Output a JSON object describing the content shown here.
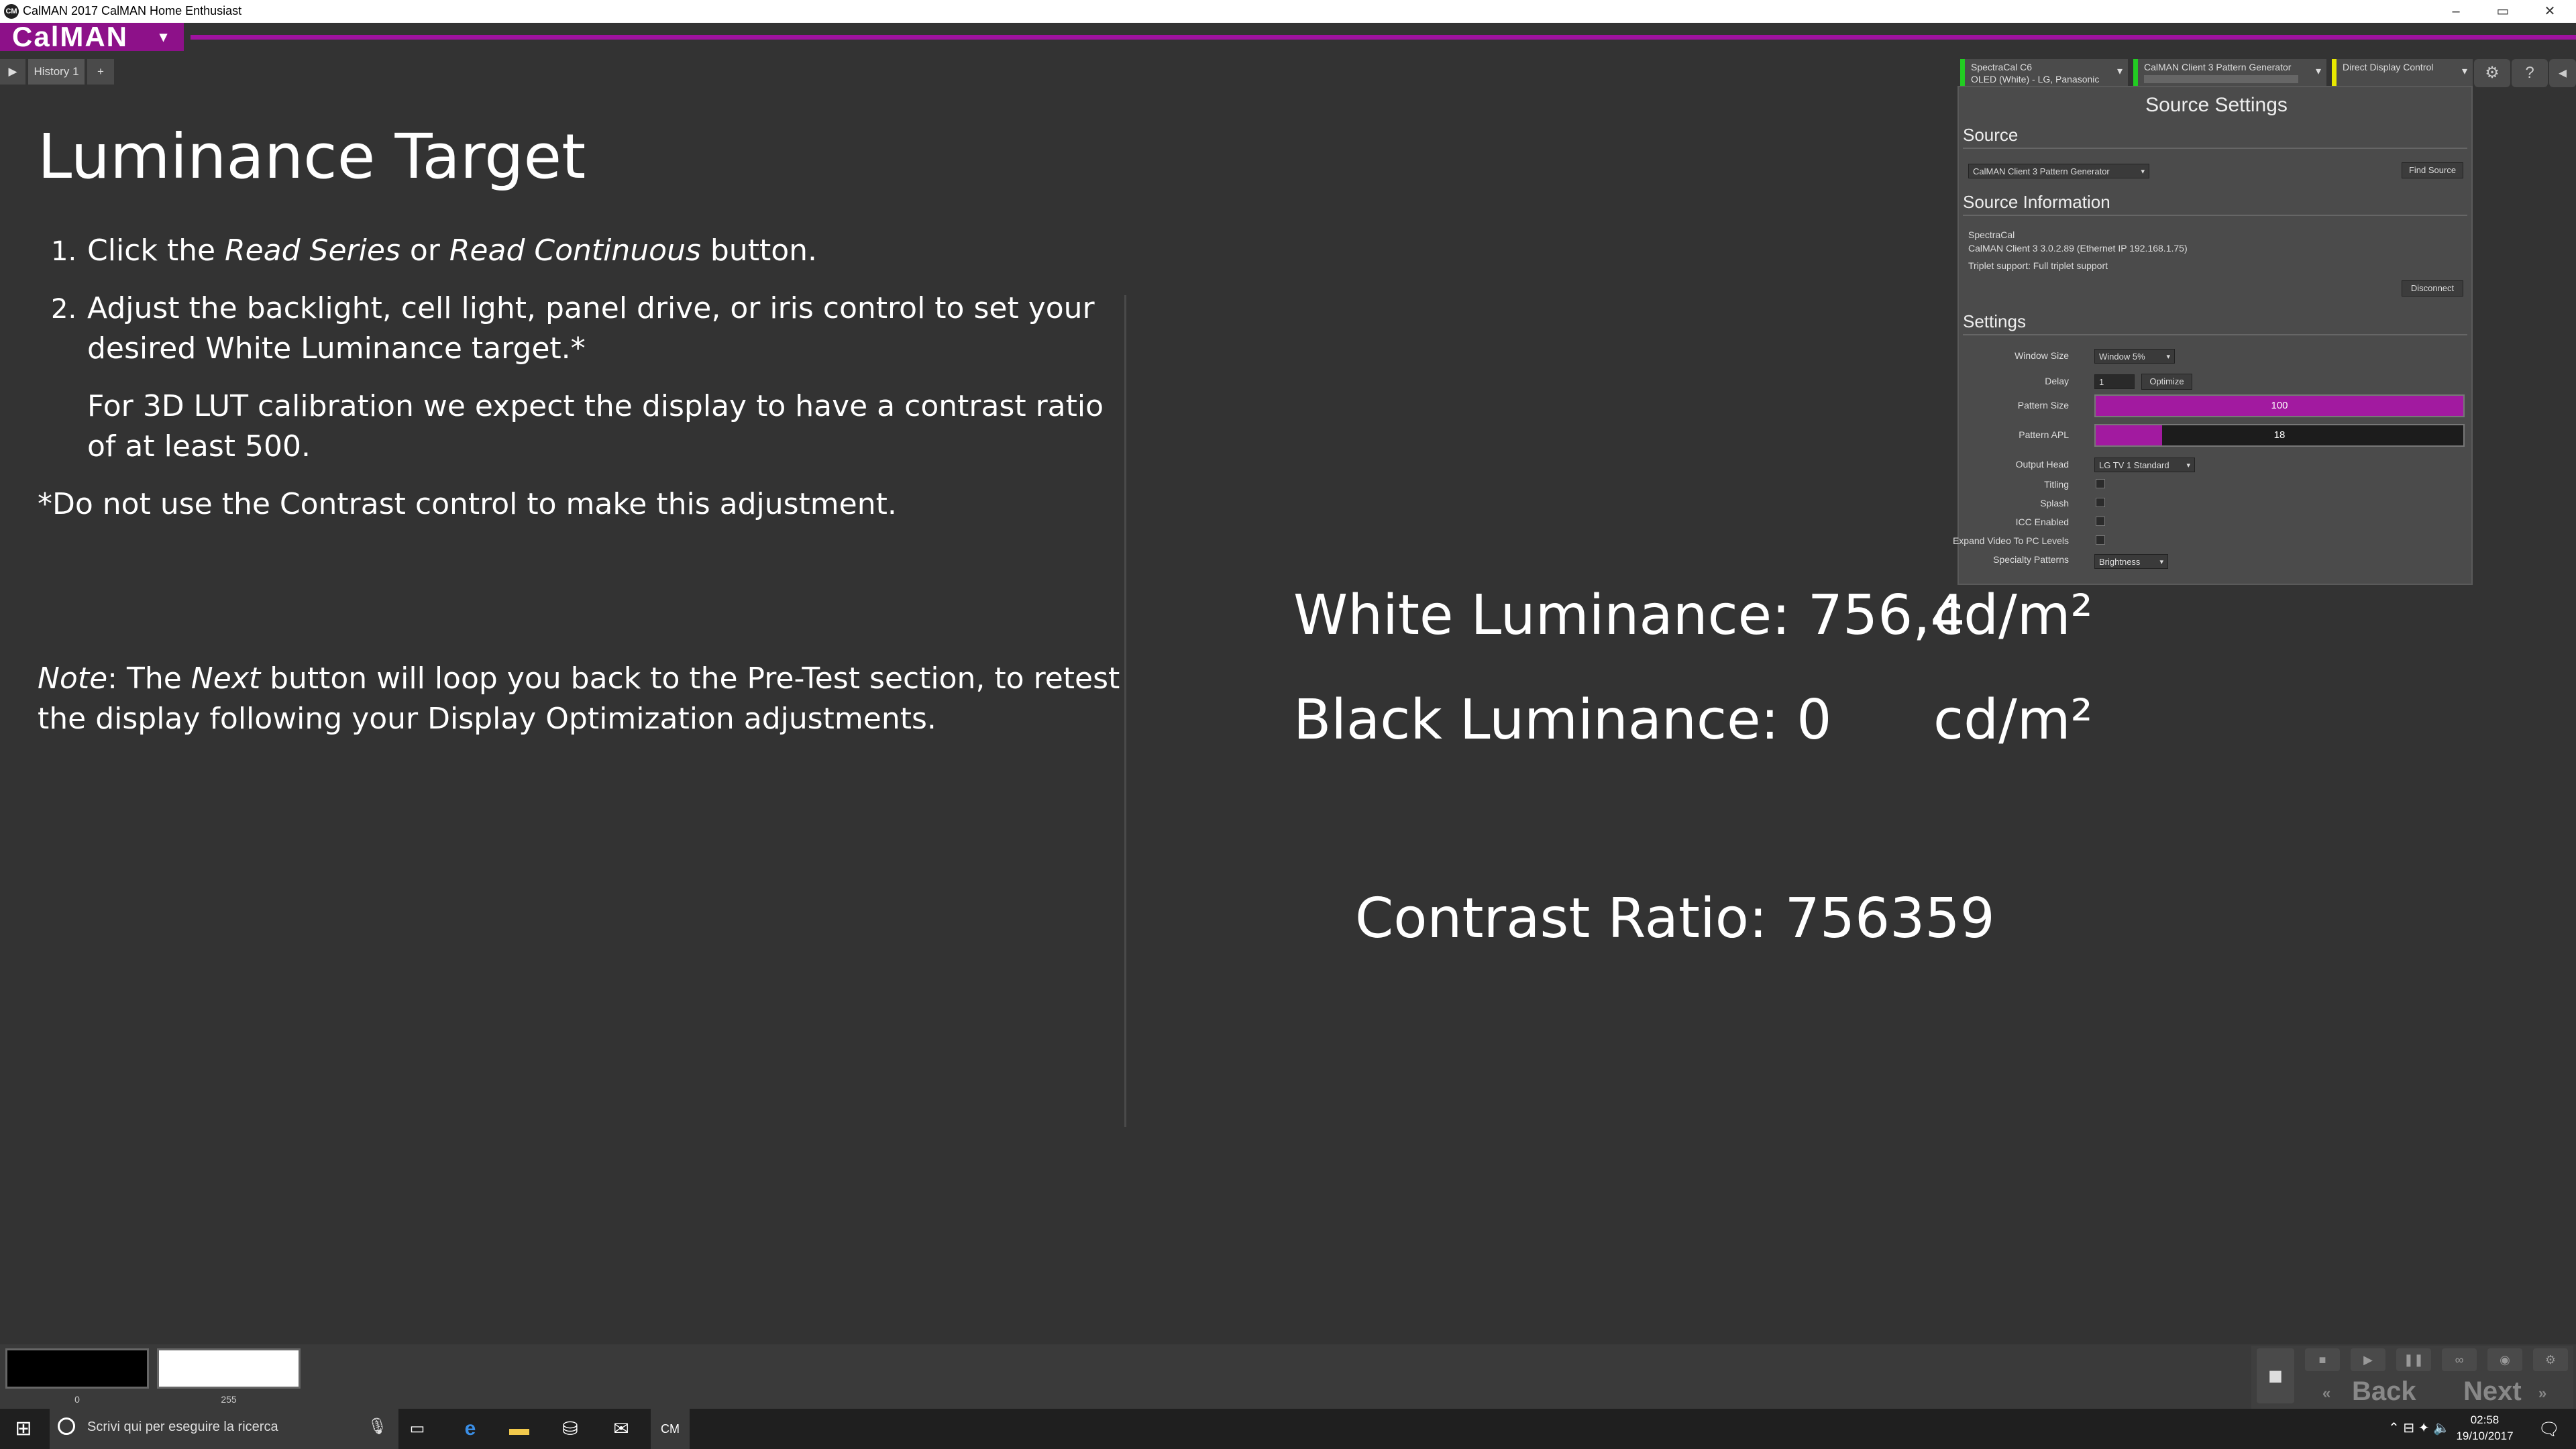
{
  "window": {
    "app_icon": "CM",
    "title": "CalMAN 2017 CalMAN Home Enthusiast",
    "controls": [
      "–",
      "▭",
      "✕"
    ]
  },
  "logo": {
    "text": "CalMAN",
    "caret": "▾"
  },
  "tabs": {
    "play_icon": "▶",
    "history_label": "History 1",
    "add_label": "+"
  },
  "devices": [
    {
      "line1": "SpectraCal C6",
      "line2": "OLED (White) - LG, Panasonic",
      "status_color": "#22cc22"
    },
    {
      "line1": "CalMAN Client 3 Pattern Generator",
      "line2": "",
      "status_color": "#22cc22"
    },
    {
      "line1": "Direct Display Control",
      "line2": "",
      "status_color": "#e8e800"
    }
  ],
  "header_icons": [
    "gear-icon",
    "help-icon",
    "back-arrow-icon"
  ],
  "instructions": {
    "heading": "Luminance Target",
    "step1_num": "1.",
    "step1_a": "Click the ",
    "step1_read_series": "Read Series",
    "step1_or": " or ",
    "step1_read_cont": "Read Continuous",
    "step1_b": " button.",
    "step2_num": "2.",
    "step2_line1": "Adjust the backlight, cell light, panel drive, or iris control to set your",
    "step2_line2": "desired White Luminance target.*",
    "lut_line1": "For 3D LUT calibration we expect the display to have a contrast ratio",
    "lut_line2": "of at least 500.",
    "footnote": "*Do not use the Contrast control to make this adjustment.",
    "note_label": "Note",
    "note_a": ": The ",
    "note_next": "Next",
    "note_b": " button will loop you back to the Pre-Test section, to retest",
    "note_line2": "the display following your Display Optimization adjustments."
  },
  "readouts": {
    "white_label": "White Luminance: 756,4",
    "white_unit": "cd/m²",
    "black_label": "Black Luminance:  0",
    "black_unit": "cd/m²",
    "contrast": "Contrast Ratio: 756359"
  },
  "source_settings": {
    "title": "Source Settings",
    "source_section": "Source",
    "source_select": "CalMAN Client 3 Pattern Generator",
    "find_source": "Find Source",
    "info_section": "Source Information",
    "info_line1": "SpectraCal",
    "info_line2": "CalMAN Client 3 3.0.2.89 (Ethernet IP 192.168.1.75)",
    "info_line3": "Triplet support: Full triplet support",
    "disconnect": "Disconnect",
    "settings_section": "Settings",
    "window_size_label": "Window Size",
    "window_size_value": "Window 5%",
    "delay_label": "Delay",
    "delay_value": "1",
    "optimize": "Optimize",
    "pattern_size_label": "Pattern Size",
    "pattern_size_value": "100",
    "pattern_size_pct": 100,
    "pattern_apl_label": "Pattern APL",
    "pattern_apl_value": "18",
    "pattern_apl_pct": 18,
    "output_head_label": "Output Head",
    "output_head_value": "LG TV 1 Standard",
    "titling_label": "Titling",
    "splash_label": "Splash",
    "icc_label": "ICC Enabled",
    "expand_label": "Expand Video To PC Levels",
    "specialty_label": "Specialty Patterns",
    "specialty_value": "Brightness"
  },
  "swatches": {
    "black_label": "0",
    "white_label": "255"
  },
  "navigation": {
    "back": "Back",
    "next": "Next"
  },
  "taskbar": {
    "search_placeholder": "Scrivi qui per eseguire la ricerca",
    "time": "02:58",
    "date": "19/10/2017"
  },
  "colors": {
    "accent": "#a012a0",
    "background": "#333333"
  }
}
